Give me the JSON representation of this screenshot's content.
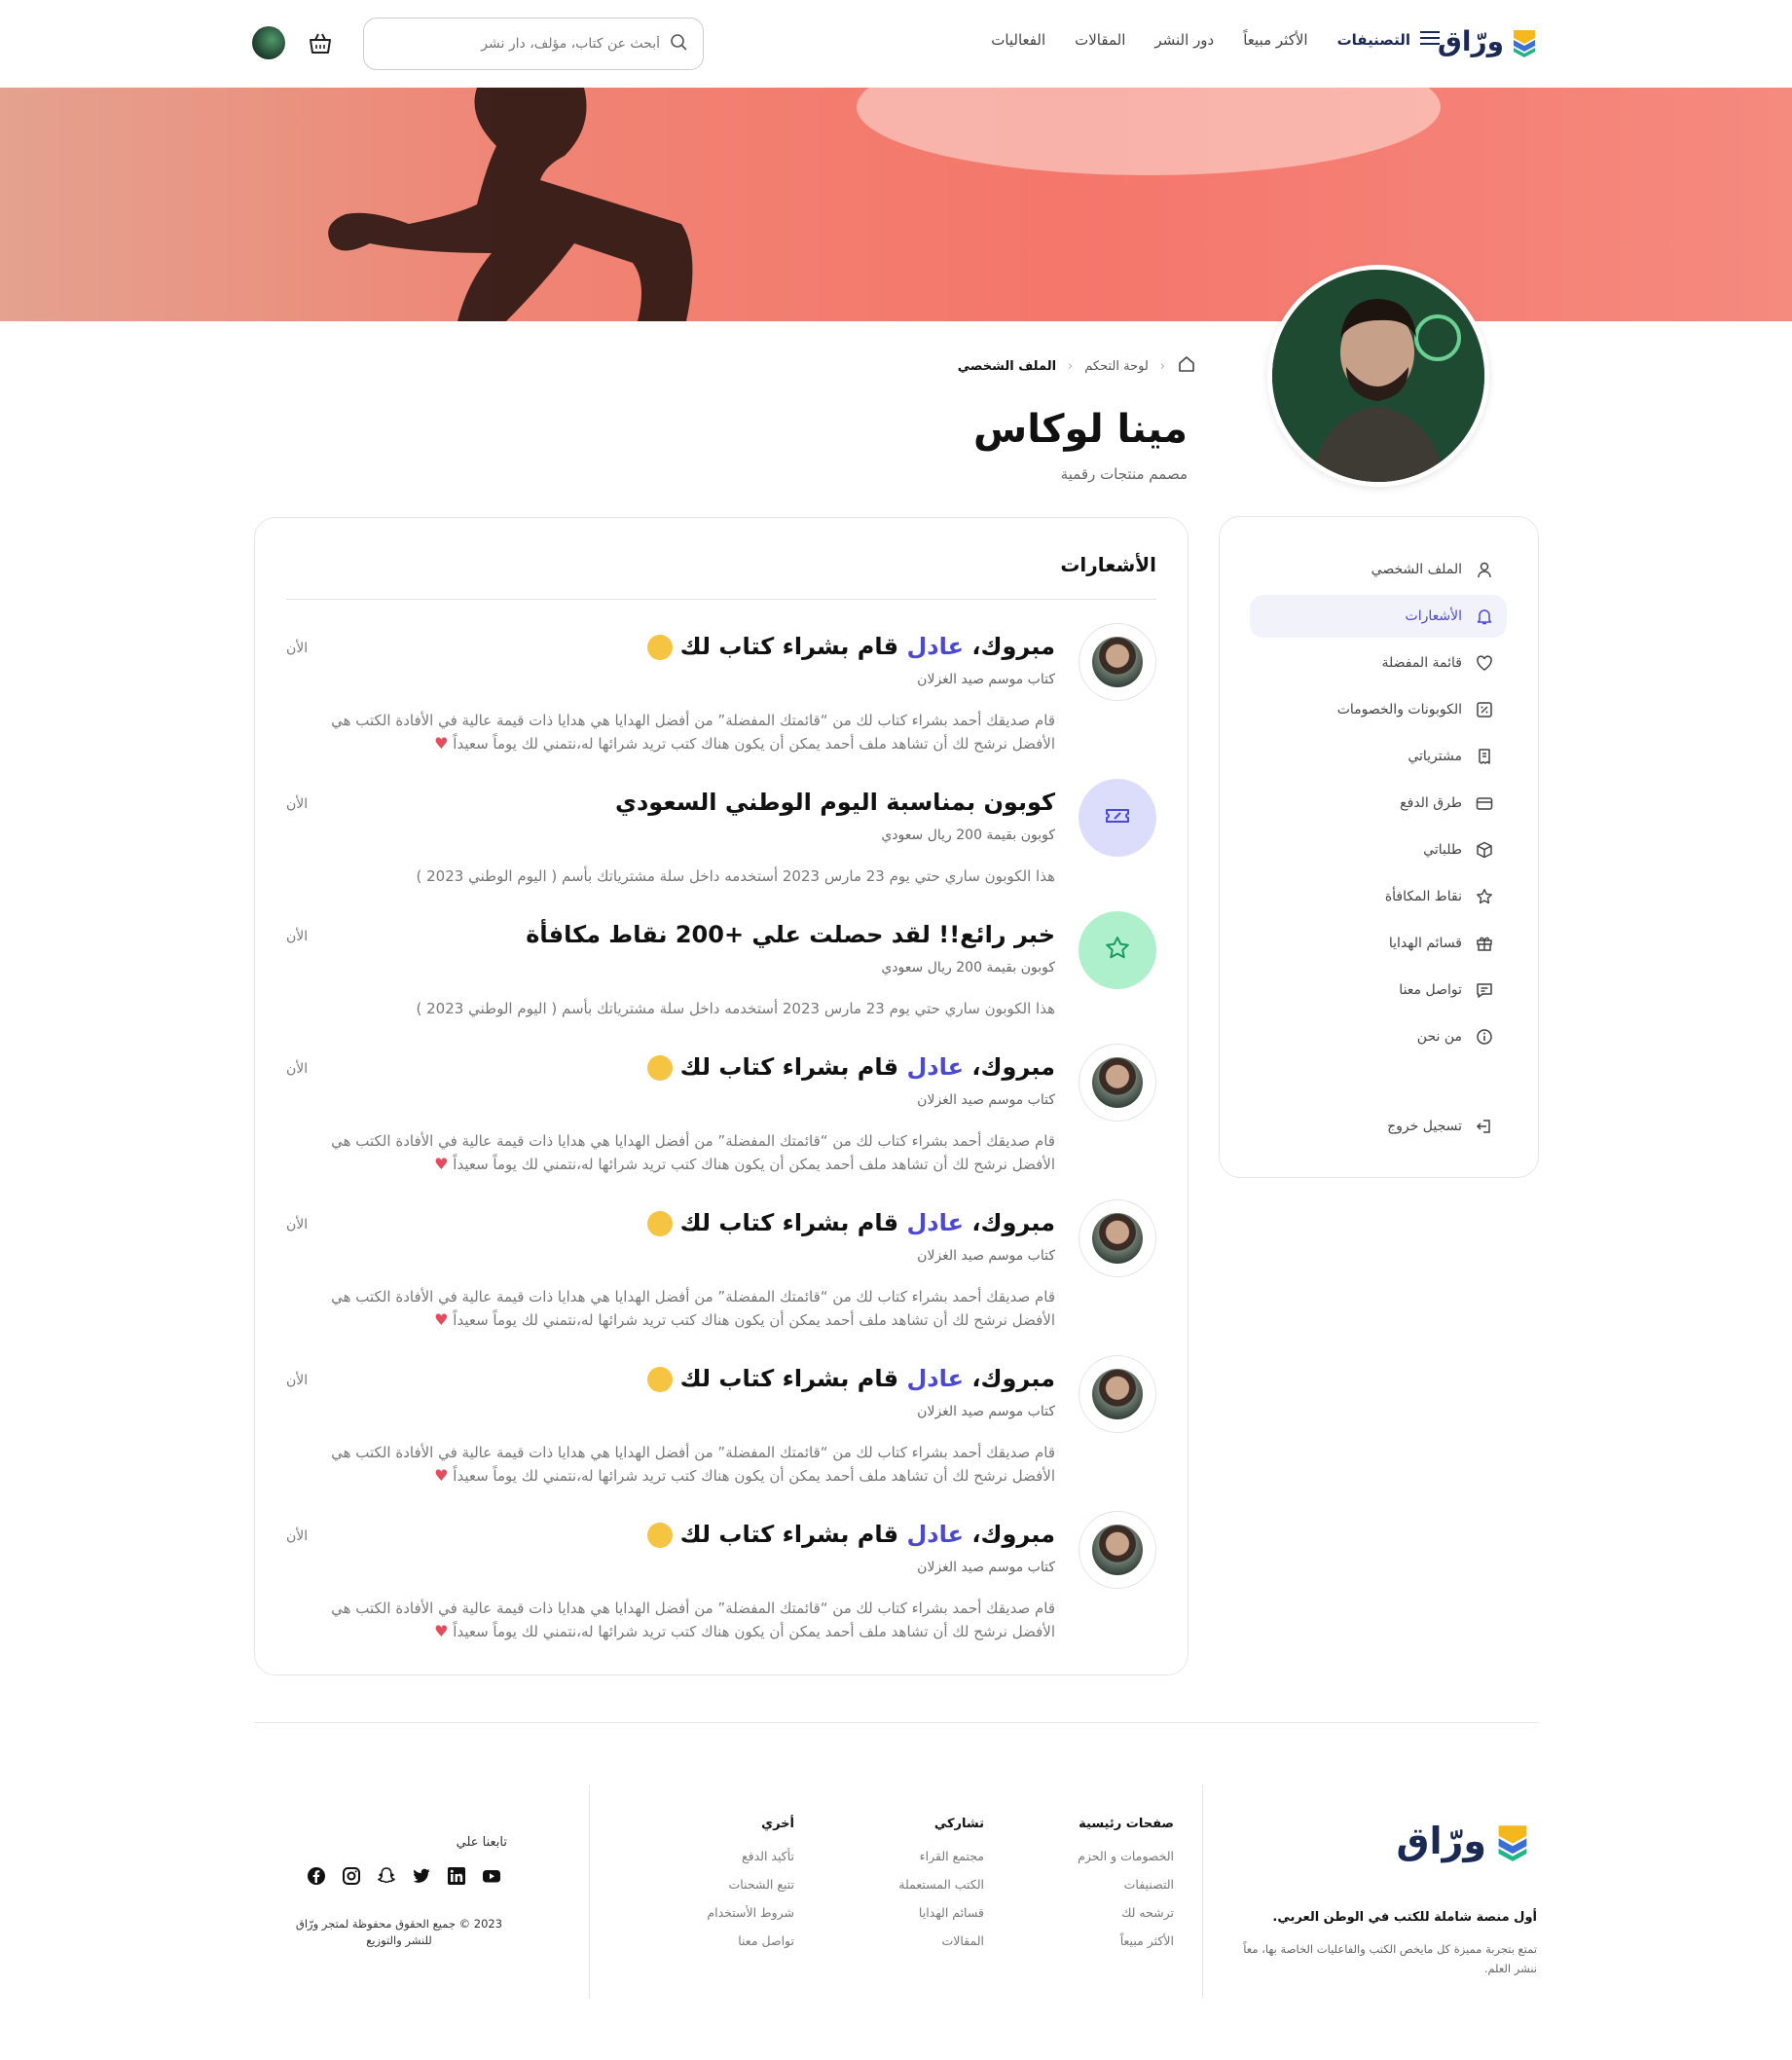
{
  "header": {
    "logo_text": "ورّاق",
    "nav": {
      "categories": "التصنيفات",
      "best_sellers": "الأكثر مبيعاً",
      "publishers": "دور النشر",
      "articles": "المقالات",
      "events": "الفعاليات"
    },
    "search_placeholder": "أبحث عن كتاب، مؤلف، دار نشر"
  },
  "breadcrumb": {
    "dashboard": "لوحة التحكم",
    "current": "الملف الشخصي"
  },
  "profile": {
    "name": "مينا لوكاس",
    "role": "مصمم منتجات رقمية"
  },
  "sidebar": {
    "items": [
      {
        "label": "الملف الشخصي",
        "icon": "user-icon"
      },
      {
        "label": "الأشعارات",
        "icon": "bell-icon"
      },
      {
        "label": "قائمة المفضلة",
        "icon": "heart-icon"
      },
      {
        "label": "الكوبونات والخصومات",
        "icon": "discount-icon"
      },
      {
        "label": "مشترياتي",
        "icon": "receipt-icon"
      },
      {
        "label": "طرق الدفع",
        "icon": "card-icon"
      },
      {
        "label": "طلباتي",
        "icon": "box-icon"
      },
      {
        "label": "نقاط المكافأة",
        "icon": "star-icon"
      },
      {
        "label": "قسائم الهدايا",
        "icon": "gift-icon"
      },
      {
        "label": "تواصل معنا",
        "icon": "chat-icon"
      },
      {
        "label": "من نحن",
        "icon": "info-icon"
      }
    ],
    "logout": "تسجيل خروج"
  },
  "notifications": {
    "title": "الأشعارات",
    "items": [
      {
        "type": "purchase",
        "title_a": "مبروك، ",
        "title_name": "عادل",
        "title_b": " قام بشراء كتاب لك",
        "subtitle": "كتاب موسم صيد الغزلان",
        "body": "قام صديقك أحمد بشراء كتاب لك من “قائمتك المفضلة” من أفضل الهدايا هي هدايا ذات قيمة عالية في الأفادة الكتب هي الأفضل نرشح لك أن تشاهد ملف أحمد يمكن أن يكون هناك كتب تريد شرائها له،نتمني لك يوماً سعيداً",
        "time": "الأن"
      },
      {
        "type": "coupon",
        "title": "كوبون بمناسبة اليوم الوطني السعودي",
        "subtitle": "كوبون بقيمة 200 ريال سعودي",
        "body": "هذا الكوبون ساري حتي يوم 23 مارس 2023 أستخدمه داخل سلة مشترياتك بأسم ( اليوم الوطني 2023 )",
        "time": "الأن"
      },
      {
        "type": "points",
        "title": "خبر رائع!! لقد حصلت علي +200 نقاط مكافأة",
        "subtitle": "كوبون بقيمة 200 ريال سعودي",
        "body": "هذا الكوبون ساري حتي يوم 23 مارس 2023 أستخدمه داخل سلة مشترياتك بأسم ( اليوم الوطني 2023 )",
        "time": "الأن"
      },
      {
        "type": "purchase",
        "title_a": "مبروك، ",
        "title_name": "عادل",
        "title_b": " قام بشراء كتاب لك",
        "subtitle": "كتاب موسم صيد الغزلان",
        "body": "قام صديقك أحمد بشراء كتاب لك من “قائمتك المفضلة” من أفضل الهدايا هي هدايا ذات قيمة عالية في الأفادة الكتب هي الأفضل نرشح لك أن تشاهد ملف أحمد يمكن أن يكون هناك كتب تريد شرائها له،نتمني لك يوماً سعيداً",
        "time": "الأن"
      },
      {
        "type": "purchase",
        "title_a": "مبروك، ",
        "title_name": "عادل",
        "title_b": " قام بشراء كتاب لك",
        "subtitle": "كتاب موسم صيد الغزلان",
        "body": "قام صديقك أحمد بشراء كتاب لك من “قائمتك المفضلة” من أفضل الهدايا هي هدايا ذات قيمة عالية في الأفادة الكتب هي الأفضل نرشح لك أن تشاهد ملف أحمد يمكن أن يكون هناك كتب تريد شرائها له،نتمني لك يوماً سعيداً",
        "time": "الأن"
      },
      {
        "type": "purchase",
        "title_a": "مبروك، ",
        "title_name": "عادل",
        "title_b": " قام بشراء كتاب لك",
        "subtitle": "كتاب موسم صيد الغزلان",
        "body": "قام صديقك أحمد بشراء كتاب لك من “قائمتك المفضلة” من أفضل الهدايا هي هدايا ذات قيمة عالية في الأفادة الكتب هي الأفضل نرشح لك أن تشاهد ملف أحمد يمكن أن يكون هناك كتب تريد شرائها له،نتمني لك يوماً سعيداً",
        "time": "الأن"
      },
      {
        "type": "purchase",
        "title_a": "مبروك، ",
        "title_name": "عادل",
        "title_b": " قام بشراء كتاب لك",
        "subtitle": "كتاب موسم صيد الغزلان",
        "body": "قام صديقك أحمد بشراء كتاب لك من “قائمتك المفضلة” من أفضل الهدايا هي هدايا ذات قيمة عالية في الأفادة الكتب هي الأفضل نرشح لك أن تشاهد ملف أحمد يمكن أن يكون هناك كتب تريد شرائها له،نتمني لك يوماً سعيداً",
        "time": "الأن"
      }
    ]
  },
  "footer": {
    "logo_text": "ورّاق",
    "tagline": "أول منصة شاملة للكتب في الوطن العربي.",
    "description": "تمتع بتجربة مميزة كل مايخص الكتب والفاعليات الخاصة بها، معاً ننشر العلم.",
    "columns": [
      {
        "title": "صفحات رئيسية",
        "links": [
          "الخصومات و الحزم",
          "التصنيفات",
          "ترشحه لك",
          "الأكثر مبيعاً"
        ]
      },
      {
        "title": "تشاركي",
        "links": [
          "مجتمع القراء",
          "الكتب المستعملة",
          "قسائم الهدايا",
          "المقالات"
        ]
      },
      {
        "title": "أخري",
        "links": [
          "تأكيد الدفع",
          "تتبع الشحنات",
          "شروط الأستخدام",
          "تواصل معنا"
        ]
      }
    ],
    "follow_label": "تابعنا علي",
    "socials": [
      "facebook-icon",
      "instagram-icon",
      "snapchat-icon",
      "twitter-icon",
      "linkedin-icon",
      "youtube-icon"
    ],
    "copyright": "2023 © جميع الحقوق محفوظة لمتجر ورّاق للنشر والتوزيع"
  },
  "colors": {
    "accent": "#4b48d3",
    "brand_dark": "#1b2a55",
    "banner": "#f5766b",
    "coupon_bg": "#dcdcfb",
    "points_bg": "#aff0cc"
  }
}
